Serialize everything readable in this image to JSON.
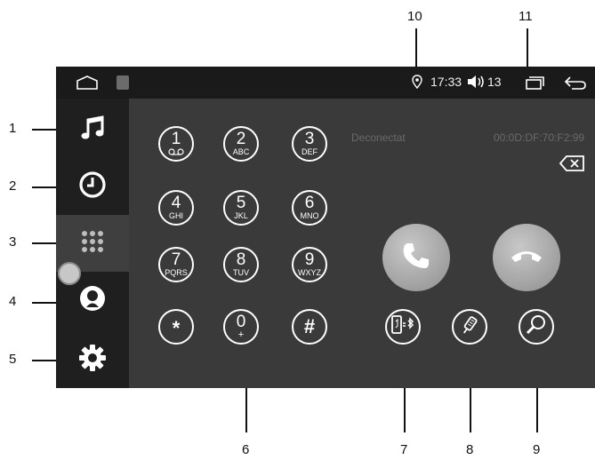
{
  "status_bar": {
    "time": "17:33",
    "volume": "13"
  },
  "connection": {
    "status": "Deconectat",
    "device_address": "00:0D:DF:70:F2:99"
  },
  "dialpad": [
    {
      "digit": "1",
      "letters": "o_o"
    },
    {
      "digit": "2",
      "letters": "ABC"
    },
    {
      "digit": "3",
      "letters": "DEF"
    },
    {
      "digit": "4",
      "letters": "GHI"
    },
    {
      "digit": "5",
      "letters": "JKL"
    },
    {
      "digit": "6",
      "letters": "MNO"
    },
    {
      "digit": "7",
      "letters": "PQRS"
    },
    {
      "digit": "8",
      "letters": "TUV"
    },
    {
      "digit": "9",
      "letters": "WXYZ"
    },
    {
      "symbol": "*"
    },
    {
      "digit": "0",
      "letters": "+"
    },
    {
      "symbol": "#"
    }
  ],
  "sidebar": {
    "items": [
      "music-icon",
      "recent-calls-icon",
      "dialpad-icon",
      "contacts-icon",
      "settings-icon"
    ],
    "active": "dialpad-icon"
  },
  "callouts": {
    "c1": "1",
    "c2": "2",
    "c3": "3",
    "c4": "4",
    "c5": "5",
    "c6": "6",
    "c7": "7",
    "c8": "8",
    "c9": "9",
    "c10": "10",
    "c11": "11"
  },
  "colors": {
    "screen_bg": "#3a3a3a",
    "sidebar_bg": "#1f1f1f",
    "status_bg": "#1a1a1a",
    "call_button": "#a8a8a8"
  }
}
